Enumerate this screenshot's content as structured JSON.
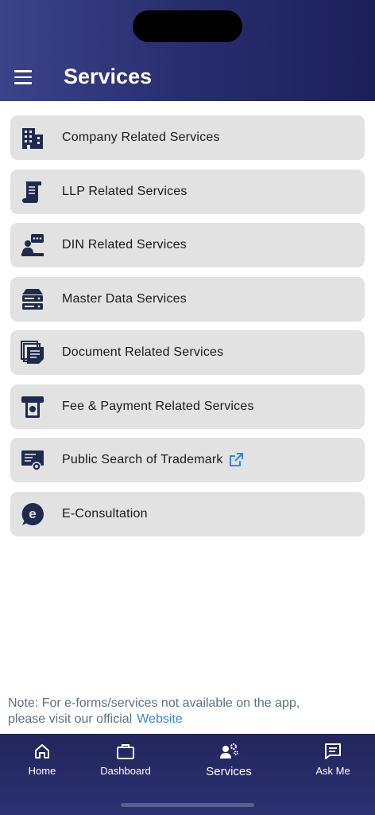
{
  "header": {
    "title": "Services"
  },
  "services": [
    {
      "label": "Company Related Services",
      "icon": "building-icon"
    },
    {
      "label": "LLP Related Services",
      "icon": "scroll-icon"
    },
    {
      "label": "DIN Related Services",
      "icon": "presenter-icon"
    },
    {
      "label": "Master Data Services",
      "icon": "server-icon"
    },
    {
      "label": "Document Related Services",
      "icon": "documents-icon"
    },
    {
      "label": "Fee & Payment Related Services",
      "icon": "payment-icon"
    },
    {
      "label": "Public Search of Trademark",
      "icon": "certificate-icon",
      "external": true
    },
    {
      "label": "E-Consultation",
      "icon": "e-chat-icon"
    }
  ],
  "note": {
    "line1": "Note: For e-forms/services not available on the app,",
    "line2": "please visit our official",
    "link": "Website"
  },
  "tabs": [
    {
      "label": "Home",
      "icon": "home-icon"
    },
    {
      "label": "Dashboard",
      "icon": "briefcase-icon"
    },
    {
      "label": "Services",
      "icon": "services-icon",
      "active": true
    },
    {
      "label": "Ask Me",
      "icon": "chat-icon"
    }
  ],
  "colors": {
    "header": "#2a2f70",
    "card": "#e2e2e2",
    "icon": "#1f2b4e",
    "link": "#3a86dc"
  }
}
